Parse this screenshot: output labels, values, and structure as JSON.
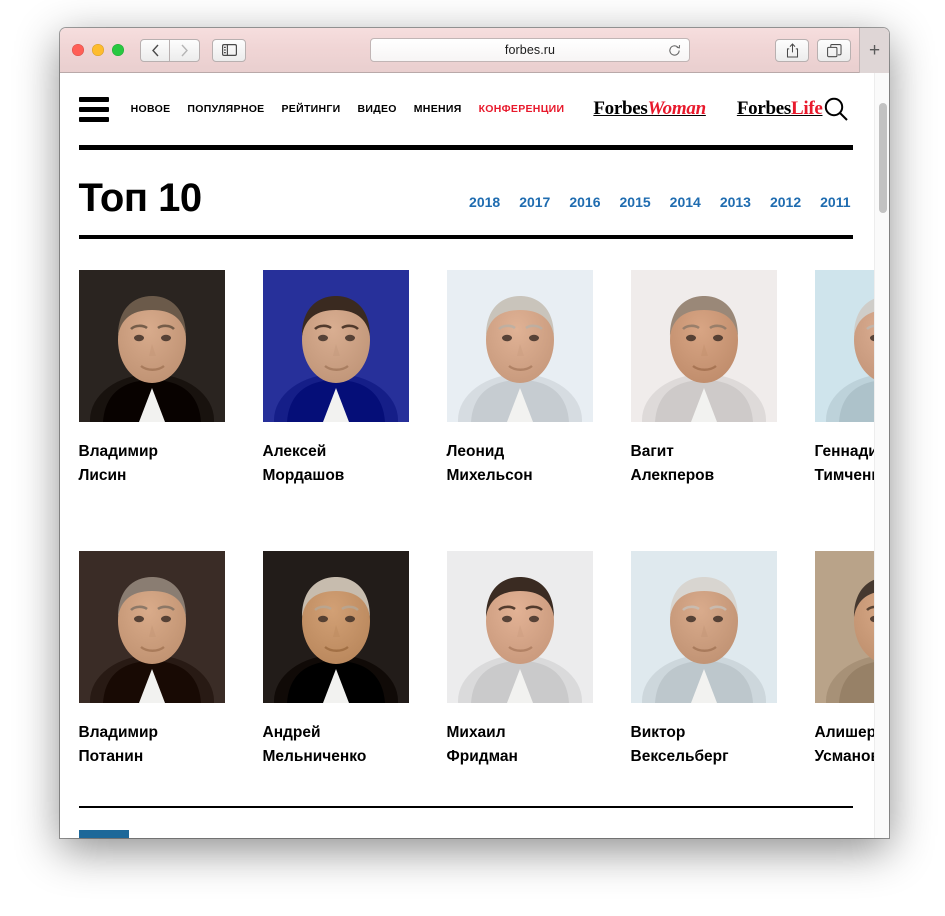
{
  "browser": {
    "address": "forbes.ru",
    "icons": {
      "back": "back-arrow-icon",
      "forward": "forward-arrow-icon",
      "sidebar": "sidebar-toggle-icon",
      "reload": "reload-icon",
      "share": "share-icon",
      "tabs": "show-tabs-icon",
      "new_tab": "+"
    }
  },
  "site": {
    "nav": [
      {
        "label": "НОВОЕ",
        "accent": false
      },
      {
        "label": "ПОПУЛЯРНОЕ",
        "accent": false
      },
      {
        "label": "РЕЙТИНГИ",
        "accent": false
      },
      {
        "label": "ВИДЕО",
        "accent": false
      },
      {
        "label": "МНЕНИЯ",
        "accent": false
      },
      {
        "label": "КОНФЕРЕНЦИИ",
        "accent": true
      }
    ],
    "brands": [
      {
        "black": "Forbes",
        "red": "Woman",
        "italic": true
      },
      {
        "black": "Forbes",
        "red": "Life",
        "italic": false
      }
    ],
    "accent_color": "#e8192c",
    "link_color": "#1f6cb0",
    "button_color": "#1d6899"
  },
  "main": {
    "title": "Топ 10",
    "years": [
      "2018",
      "2017",
      "2016",
      "2015",
      "2014",
      "2013",
      "2012",
      "2011"
    ],
    "people": [
      {
        "first": "Владимир",
        "last": "Лисин",
        "bg": "#2a2420",
        "skin": "#d8ab8c",
        "hair": "#6b5a4a"
      },
      {
        "first": "Алексей",
        "last": "Мордашов",
        "bg": "#27309a",
        "skin": "#d9ae91",
        "hair": "#3a2a20"
      },
      {
        "first": "Леонид",
        "last": "Михельсон",
        "bg": "#e8eef3",
        "skin": "#e0b295",
        "hair": "#c9c4bb"
      },
      {
        "first": "Вагит",
        "last": "Алекперов",
        "bg": "#f0eceb",
        "skin": "#d8a584",
        "hair": "#9a8878"
      },
      {
        "first": "Геннадий",
        "last": "Тимченко",
        "bg": "#cfe4ec",
        "skin": "#dcae92",
        "hair": "#cfcdc9"
      },
      {
        "first": "Владимир",
        "last": "Потанин",
        "bg": "#3a2c26",
        "skin": "#d9ab8a",
        "hair": "#8a7d72"
      },
      {
        "first": "Андрей",
        "last": "Мельниченко",
        "bg": "#221c19",
        "skin": "#d2a075",
        "hair": "#c7bcae"
      },
      {
        "first": "Михаил",
        "last": "Фридман",
        "bg": "#ececed",
        "skin": "#e2b295",
        "hair": "#3a2b22"
      },
      {
        "first": "Виктор",
        "last": "Вексельберг",
        "bg": "#dfe9ee",
        "skin": "#d9ab8c",
        "hair": "#d8d5d0"
      },
      {
        "first": "Алишер",
        "last": "Усманов",
        "bg": "#b9a389",
        "skin": "#d7a886",
        "hair": "#45382f"
      }
    ],
    "scroll_top_icon": "chevron-up-icon"
  }
}
